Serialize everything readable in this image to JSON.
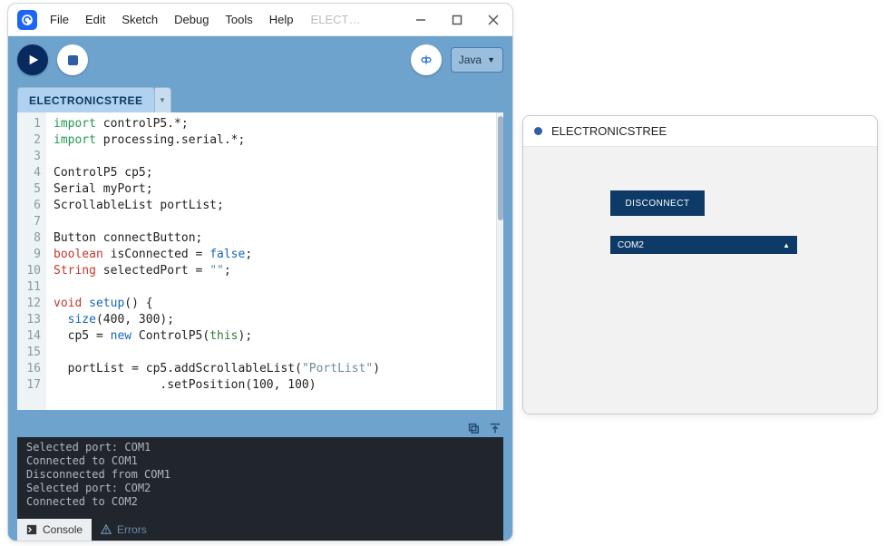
{
  "ide": {
    "menu": [
      "File",
      "Edit",
      "Sketch",
      "Debug",
      "Tools",
      "Help"
    ],
    "title_truncated": "ELECTR…",
    "mode_label": "Java",
    "tab_label": "ELECTRONICSTREE",
    "code_lines": [
      {
        "n": 1,
        "html": "<span class='im'>import</span> controlP5.*;"
      },
      {
        "n": 2,
        "html": "<span class='im'>import</span> processing.serial.*;"
      },
      {
        "n": 3,
        "html": ""
      },
      {
        "n": 4,
        "html": "ControlP5 cp5;"
      },
      {
        "n": 5,
        "html": "Serial myPort;"
      },
      {
        "n": 6,
        "html": "ScrollableList portList;"
      },
      {
        "n": 7,
        "html": ""
      },
      {
        "n": 8,
        "html": "Button connectButton;"
      },
      {
        "n": 9,
        "html": "<span class='kw'>boolean</span> isConnected = <span class='bl'>false</span>;"
      },
      {
        "n": 10,
        "html": "<span class='kw'>String</span> selectedPort = <span class='st'>\"\"</span>;"
      },
      {
        "n": 11,
        "html": ""
      },
      {
        "n": 12,
        "html": "<span class='kw'>void</span> <span class='bl'>setup</span>() {"
      },
      {
        "n": 13,
        "html": "  <span class='bl'>size</span>(400, 300);"
      },
      {
        "n": 14,
        "html": "  cp5 = <span class='bl'>new</span> ControlP5(<span class='th'>this</span>);"
      },
      {
        "n": 15,
        "html": ""
      },
      {
        "n": 16,
        "html": "  portList = cp5.addScrollableList(<span class='st'>\"PortList\"</span>)"
      },
      {
        "n": 17,
        "html": "               .setPosition(100, 100)"
      }
    ],
    "console_lines": [
      "Selected port: COM1",
      "Connected to COM1",
      "Disconnected from COM1",
      "Selected port: COM2",
      "Connected to COM2"
    ],
    "console_tab": "Console",
    "errors_tab": "Errors"
  },
  "sketch": {
    "title": "ELECTRONICSTREE",
    "button_label": "DISCONNECT",
    "dropdown_value": "COM2"
  }
}
